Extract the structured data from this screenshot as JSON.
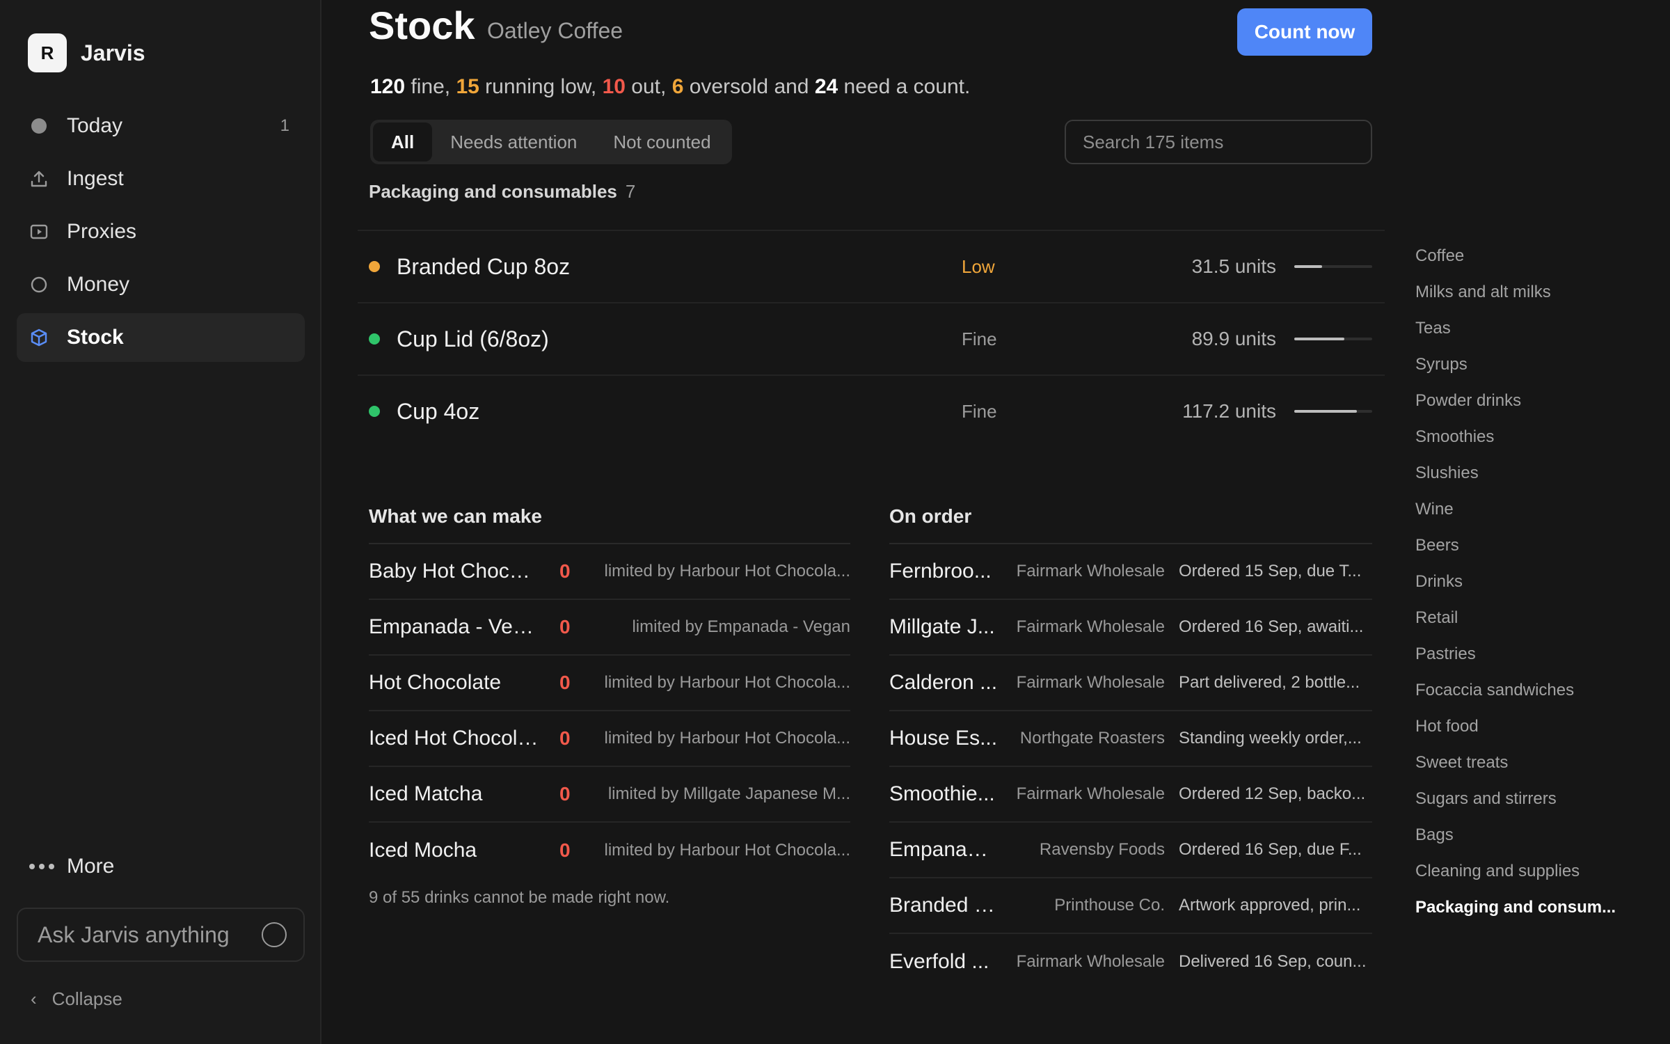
{
  "app": {
    "logo_letter": "R",
    "name": "Jarvis"
  },
  "sidebar": {
    "items": [
      {
        "label": "Today",
        "icon": "circle-filled-icon",
        "badge": "1",
        "active": false
      },
      {
        "label": "Ingest",
        "icon": "upload-icon",
        "badge": "",
        "active": false
      },
      {
        "label": "Proxies",
        "icon": "play-box-icon",
        "badge": "",
        "active": false
      },
      {
        "label": "Money",
        "icon": "circle-outline-icon",
        "badge": "",
        "active": false
      },
      {
        "label": "Stock",
        "icon": "cube-icon",
        "badge": "",
        "active": true
      }
    ],
    "more_label": "More",
    "ask_placeholder": "Ask Jarvis anything",
    "collapse_label": "Collapse"
  },
  "header": {
    "title": "Stock",
    "subtitle": "Oatley Coffee",
    "count_button": "Count now"
  },
  "summary": {
    "fine_count": "120",
    "fine_label": " fine, ",
    "low_count": "15",
    "low_label": " running low, ",
    "out_count": "10",
    "out_label": " out, ",
    "oversold_count": "6",
    "oversold_label": " oversold and ",
    "needcount_count": "24",
    "needcount_label": " need a count."
  },
  "filters": {
    "tabs": [
      {
        "label": "All",
        "active": true
      },
      {
        "label": "Needs attention",
        "active": false
      },
      {
        "label": "Not counted",
        "active": false
      }
    ],
    "search_placeholder": "Search 175 items"
  },
  "group": {
    "title": "Packaging and consumables",
    "count": "7",
    "items": [
      {
        "name": "Branded Cup 8oz",
        "status": "Low",
        "status_color": "#f0a63a",
        "dot_color": "#f0a63a",
        "qty": "31.5 units",
        "level": 0.36
      },
      {
        "name": "Cup Lid (6/8oz)",
        "status": "Fine",
        "status_color": "#9d9d9d",
        "dot_color": "#2fc46a",
        "qty": "89.9 units",
        "level": 0.64
      },
      {
        "name": "Cup 4oz",
        "status": "Fine",
        "status_color": "#9d9d9d",
        "dot_color": "#2fc46a",
        "qty": "117.2 units",
        "level": 0.8
      }
    ]
  },
  "make": {
    "title": "What we can make",
    "rows": [
      {
        "name": "Baby Hot Chocol...",
        "count": "0",
        "limit": "limited by Harbour Hot Chocola..."
      },
      {
        "name": "Empanada - Vegan",
        "count": "0",
        "limit": "limited by Empanada - Vegan"
      },
      {
        "name": "Hot Chocolate",
        "count": "0",
        "limit": "limited by Harbour Hot Chocola..."
      },
      {
        "name": "Iced Hot Chocolate",
        "count": "0",
        "limit": "limited by Harbour Hot Chocola..."
      },
      {
        "name": "Iced Matcha",
        "count": "0",
        "limit": "limited by Millgate Japanese M..."
      },
      {
        "name": "Iced Mocha",
        "count": "0",
        "limit": "limited by Harbour Hot Chocola..."
      }
    ],
    "footer": "9 of 55 drinks cannot be made right now."
  },
  "order": {
    "title": "On order",
    "rows": [
      {
        "name": "Fernbroo...",
        "supplier": "Fairmark Wholesale",
        "status": "Ordered 15 Sep, due T..."
      },
      {
        "name": "Millgate J...",
        "supplier": "Fairmark Wholesale",
        "status": "Ordered 16 Sep, awaiti..."
      },
      {
        "name": "Calderon ...",
        "supplier": "Fairmark Wholesale",
        "status": "Part delivered, 2 bottle..."
      },
      {
        "name": "House Es...",
        "supplier": "Northgate Roasters",
        "status": "Standing weekly order,..."
      },
      {
        "name": "Smoothie...",
        "supplier": "Fairmark Wholesale",
        "status": "Ordered 12 Sep, backo..."
      },
      {
        "name": "Empanada - ...",
        "supplier": "Ravensby Foods",
        "status": "Ordered 16 Sep, due F..."
      },
      {
        "name": "Branded Cup ...",
        "supplier": "Printhouse Co.",
        "status": "Artwork approved, prin..."
      },
      {
        "name": "Everfold ...",
        "supplier": "Fairmark Wholesale",
        "status": "Delivered 16 Sep, coun..."
      }
    ]
  },
  "categories": [
    {
      "label": "Coffee",
      "active": false
    },
    {
      "label": "Milks and alt milks",
      "active": false
    },
    {
      "label": "Teas",
      "active": false
    },
    {
      "label": "Syrups",
      "active": false
    },
    {
      "label": "Powder drinks",
      "active": false
    },
    {
      "label": "Smoothies",
      "active": false
    },
    {
      "label": "Slushies",
      "active": false
    },
    {
      "label": "Wine",
      "active": false
    },
    {
      "label": "Beers",
      "active": false
    },
    {
      "label": "Drinks",
      "active": false
    },
    {
      "label": "Retail",
      "active": false
    },
    {
      "label": "Pastries",
      "active": false
    },
    {
      "label": "Focaccia sandwiches",
      "active": false
    },
    {
      "label": "Hot food",
      "active": false
    },
    {
      "label": "Sweet treats",
      "active": false
    },
    {
      "label": "Sugars and stirrers",
      "active": false
    },
    {
      "label": "Bags",
      "active": false
    },
    {
      "label": "Cleaning and supplies",
      "active": false
    },
    {
      "label": "Packaging and consum...",
      "active": true
    }
  ],
  "colors": {
    "accent": "#4f86f7",
    "amber": "#f0a63a",
    "red": "#f2594b",
    "green": "#2fc46a"
  }
}
